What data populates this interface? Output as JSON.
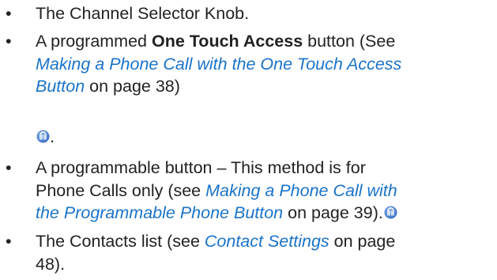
{
  "items": [
    {
      "bullet": "•",
      "text": "The Channel Selector Knob."
    },
    {
      "bullet": "•",
      "pre": "A programmed ",
      "bold": "One Touch Access",
      "mid": " button (See ",
      "link_line1": "Making a Phone Call with the One Touch Access",
      "link_line2": "Button",
      "post": " on page 38)"
    },
    {
      "period": "."
    },
    {
      "bullet": "•",
      "pre": "A programmable button – This method is for",
      "line2_pre": "Phone Calls only (see ",
      "link_line1": "Making a Phone Call with",
      "link_line2": "the Programmable Phone Button",
      "post": " on page 39)."
    },
    {
      "bullet": "•",
      "pre": "The Contacts list (see ",
      "link": "Contact Settings",
      "post_line1": " on page",
      "post_line2": "48)."
    }
  ],
  "icons": {
    "ota": "one-touch-access-icon",
    "color": "#4a7fd0"
  }
}
